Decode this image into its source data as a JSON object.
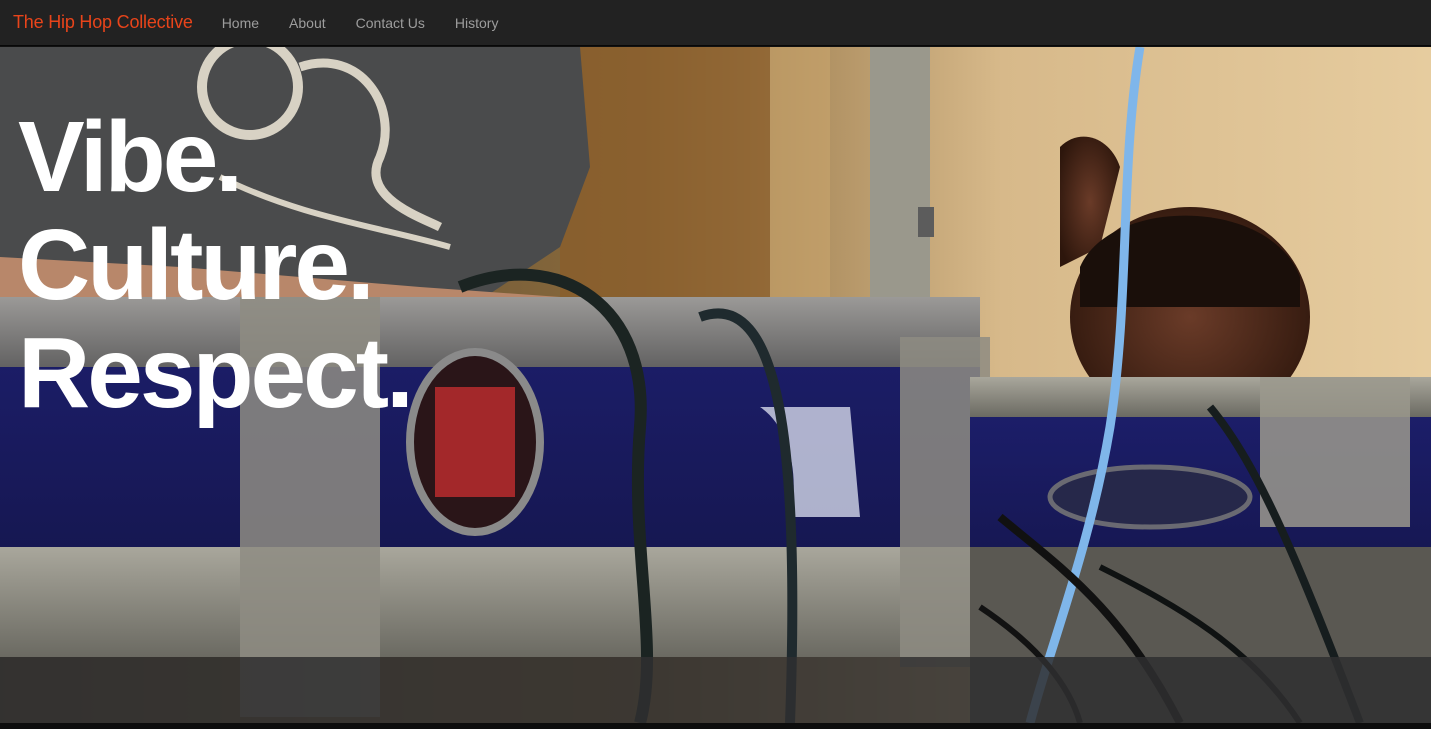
{
  "nav": {
    "brand": "The Hip Hop Collective",
    "links": [
      "Home",
      "About",
      "Contact Us",
      "History"
    ]
  },
  "hero": {
    "lines": [
      "Vibe.",
      "Culture.",
      "Respect."
    ],
    "image_alt": "DJ equipment cases with cables, two people in the background"
  },
  "colors": {
    "brand": "#e8441a",
    "navbar_bg": "#222222",
    "nav_link": "#9d9d9d",
    "headline": "#ffffff"
  }
}
